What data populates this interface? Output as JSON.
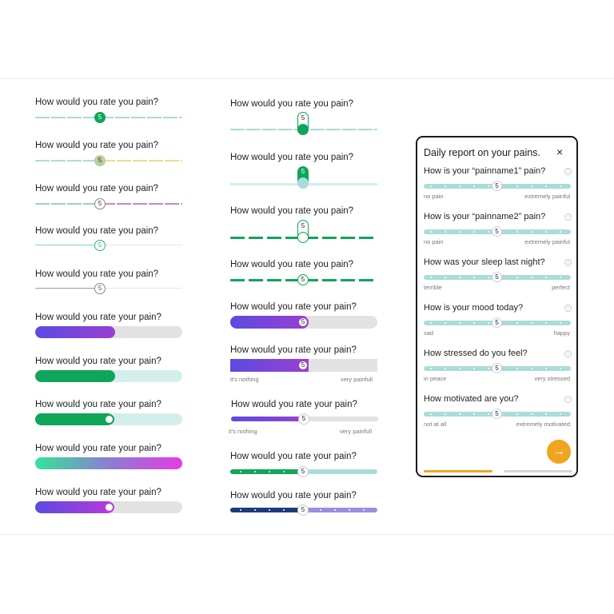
{
  "left_column": {
    "questions": [
      "How would you rate you pain?",
      "How would you rate you pain?",
      "How would you rate you pain?",
      "How would you rate you pain?",
      "How would you rate you pain?",
      "How would you rate your pain?",
      "How would you rate your pain?",
      "How would you rate your pain?",
      "How would you rate your pain?",
      "How would you rate your pain?"
    ],
    "slider_values": [
      "5",
      "5",
      "5",
      "5",
      "5"
    ]
  },
  "middle_column": {
    "questions": [
      "How would you rate you pain?",
      "How would you rate you pain?",
      "How would you rate you pain?",
      "How would you rate you pain?",
      "How would you rate your pain?",
      "How would you rate your pain?",
      "How would you rate your pain?",
      "How would you rate your pain?",
      "How would you rate your pain?"
    ],
    "slider_values": [
      "5",
      "5",
      "5",
      "5",
      "5",
      "5",
      "5",
      "5",
      "5"
    ],
    "caption_low": "it's nothing",
    "caption_high": "very painfull",
    "caption_low_2": "it's nothing",
    "caption_high_2": "very painfull"
  },
  "phone": {
    "title": "Daily report on your pains.",
    "close_icon": "×",
    "next_icon": "→",
    "info_icon": "i",
    "questions": [
      {
        "label": "How is your “painname1” pain?",
        "value": "5",
        "low": "no pain",
        "high": "extremely painful"
      },
      {
        "label": "How is your “painname2” pain?",
        "value": "5",
        "low": "no pain",
        "high": "extremely painful"
      },
      {
        "label": "How was your sleep last night?",
        "value": "5",
        "low": "terrible",
        "high": "perfect"
      },
      {
        "label": "How is your mood today?",
        "value": "5",
        "low": "sad",
        "high": "happy"
      },
      {
        "label": "How stressed do you feel?",
        "value": "5",
        "low": "in peace",
        "high": "very stressed"
      },
      {
        "label": "How motivated are you?",
        "value": "5",
        "low": "not at all",
        "high": "extremely motivated"
      }
    ]
  },
  "colors": {
    "green": "#0fa55a",
    "teal_light": "#a9dcd9",
    "purple": "#7b3fd6",
    "orange": "#f0a520",
    "navy": "#1d3b78"
  }
}
